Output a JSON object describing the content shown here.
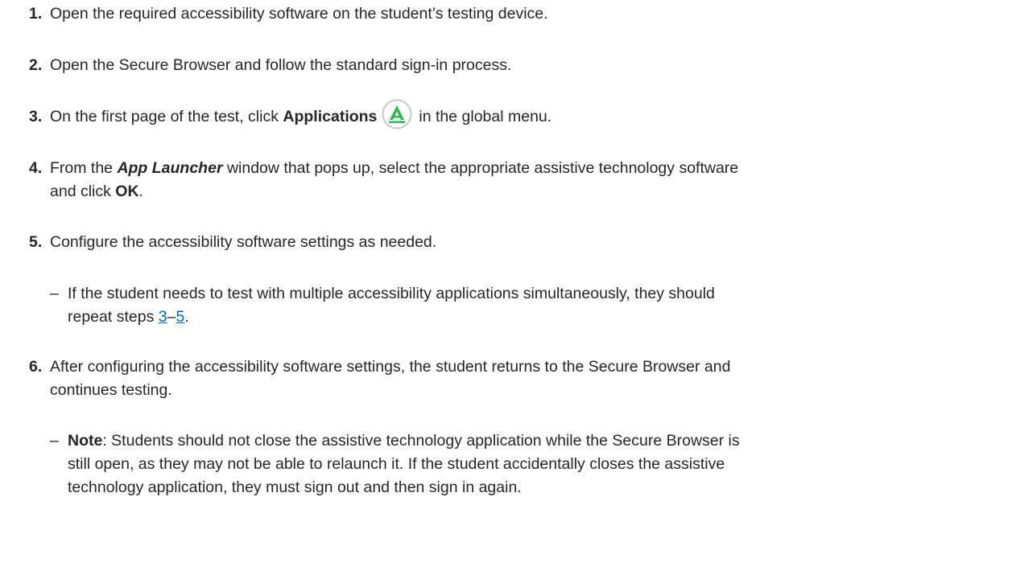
{
  "steps": [
    {
      "number": "1.",
      "text": "Open the required accessibility software on the student’s testing device."
    },
    {
      "number": "2.",
      "text": "Open the Secure Browser and follow the standard sign-in process."
    },
    {
      "number": "3.",
      "text_before": "On the first page of the test, click ",
      "bold": "Applications",
      "icon": "app-launcher-icon",
      "text_after": "in the global menu."
    },
    {
      "number": "4.",
      "text_before": "From the ",
      "bold_italic": "App Launcher",
      "text_mid": " window that pops up, select the appropriate assistive technology software",
      "line2_before": "and click ",
      "bold": "OK",
      "text_after": "."
    },
    {
      "number": "5.",
      "text": "Configure the accessibility software settings as needed."
    },
    {
      "number": "6.",
      "line1": "After configuring the accessibility software settings, the student returns to the Secure Browser and",
      "line2": "continues testing."
    }
  ],
  "sub_items": {
    "step5": {
      "dash": "–",
      "line1": "If the student needs to test with multiple accessibility applications simultaneously, they should",
      "line2_before": "repeat steps ",
      "link_start": "3",
      "range_dash": "–",
      "link_end": "5",
      "line2_after": "."
    },
    "step6": {
      "dash": "–",
      "note_label": "Note",
      "line1_after": ": Students should not close the assistive technology application while the Secure Browser is",
      "line2": "still open, as they may not be able to relaunch it. If the student accidentally closes the assistive",
      "line3": "technology application, they must sign out and then sign in again."
    }
  },
  "colors": {
    "text": "#262626",
    "link": "#0563c1",
    "icon_green": "#2db84d"
  }
}
